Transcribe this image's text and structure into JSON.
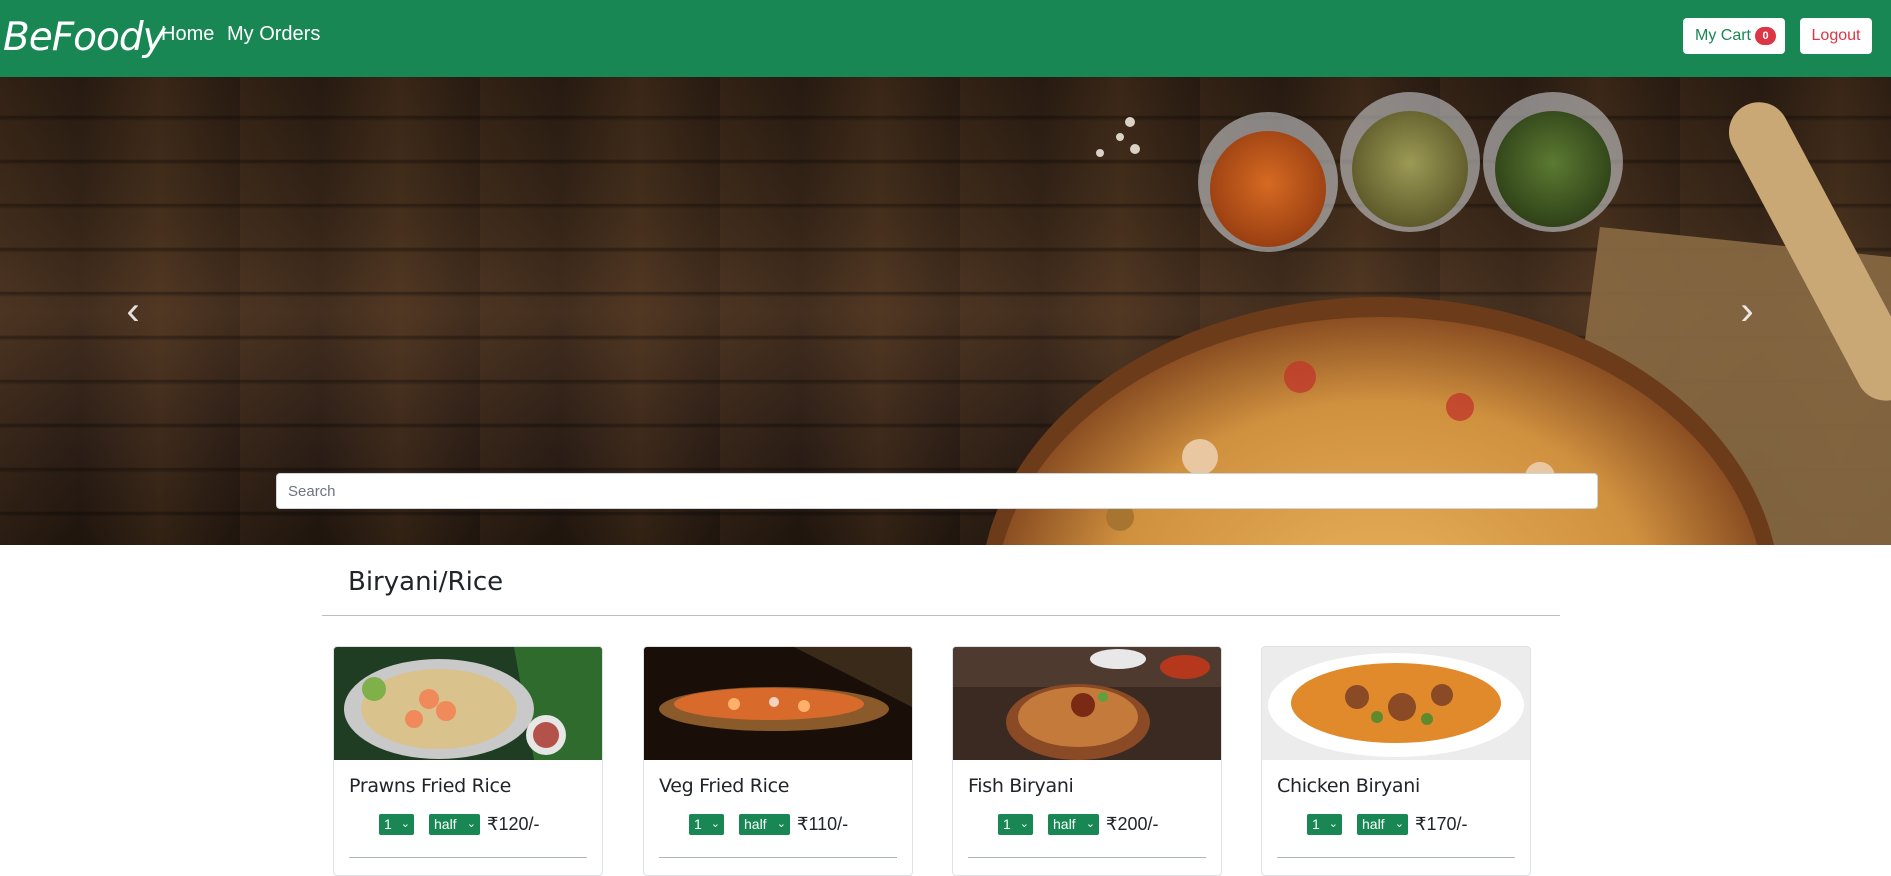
{
  "navbar": {
    "brand": "BeFoody",
    "links": {
      "home": "Home",
      "orders": "My Orders"
    },
    "cart_label": "My Cart",
    "cart_count": "0",
    "logout_label": "Logout",
    "color": "#198754"
  },
  "hero": {
    "prev_icon": "‹",
    "next_icon": "›",
    "search_placeholder": "Search"
  },
  "category": {
    "title": "Biryani/Rice",
    "items": [
      {
        "name": "Prawns Fried Rice",
        "qty": "1",
        "size": "half",
        "price": "₹120/-",
        "image": "prawns-fried-rice-image"
      },
      {
        "name": "Veg Fried Rice",
        "qty": "1",
        "size": "half",
        "price": "₹110/-",
        "image": "veg-fried-rice-image"
      },
      {
        "name": "Fish Biryani",
        "qty": "1",
        "size": "half",
        "price": "₹200/-",
        "image": "fish-biryani-image"
      },
      {
        "name": "Chicken Biryani",
        "qty": "1",
        "size": "half",
        "price": "₹170/-",
        "image": "chicken-biryani-image"
      }
    ]
  },
  "colors": {
    "accent": "#198754",
    "danger": "#dc3545"
  },
  "icons": {
    "chevron": "chevron-down-icon"
  }
}
